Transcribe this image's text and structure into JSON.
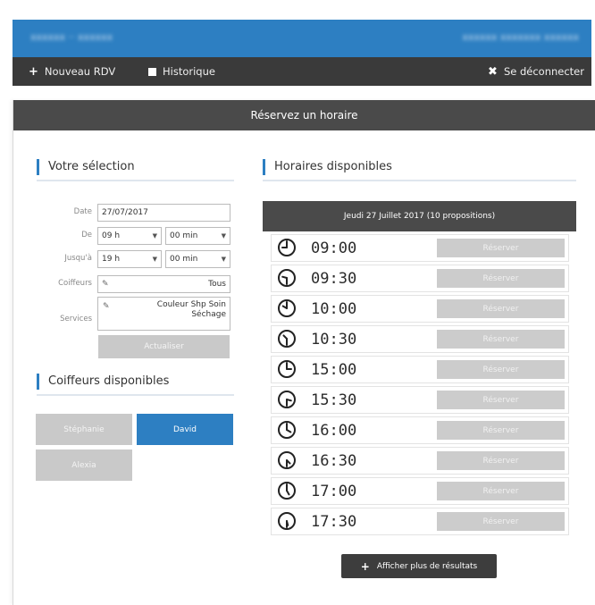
{
  "topbar": {
    "brand": "xxxxxx ·· xxxxxx",
    "user": "xxxxxx xxxxxxx xxxxxx"
  },
  "nav": {
    "new_rdv": "Nouveau RDV",
    "history": "Historique",
    "logout": "Se déconnecter"
  },
  "panel": {
    "title": "Réservez un horaire"
  },
  "selection": {
    "title": "Votre sélection",
    "date_label": "Date",
    "date_value": "27/07/2017",
    "from_label": "De",
    "from_hour": "09 h",
    "from_min": "00 min",
    "to_label": "Jusqu'à",
    "to_hour": "19 h",
    "to_min": "00 min",
    "hairdresser_label": "Coiffeurs",
    "hairdresser_value": "Tous",
    "services_label": "Services",
    "services_line1": "Couleur Shp Soin",
    "services_line2": "Séchage",
    "update_button": "Actualiser"
  },
  "stylists": {
    "title": "Coiffeurs disponibles",
    "items": [
      "Stéphanie",
      "David",
      "Alexia"
    ]
  },
  "slots": {
    "title": "Horaires disponibles",
    "date_header": "Jeudi 27 Juillet 2017 (10 propositions)",
    "book_label": "Réserver",
    "times": [
      "09:00",
      "09:30",
      "10:00",
      "10:30",
      "15:00",
      "15:30",
      "16:00",
      "16:30",
      "17:00",
      "17:30"
    ],
    "more_button": "Afficher plus de résultats"
  },
  "colors": {
    "brand_blue": "#2d7fc2",
    "dark_bar": "#3a3a3a",
    "grey_button": "#c9c9c9"
  },
  "icons": [
    "plus-icon",
    "square-icon",
    "close-icon",
    "clock-icon",
    "pencil-icon",
    "chevron-down-icon"
  ]
}
